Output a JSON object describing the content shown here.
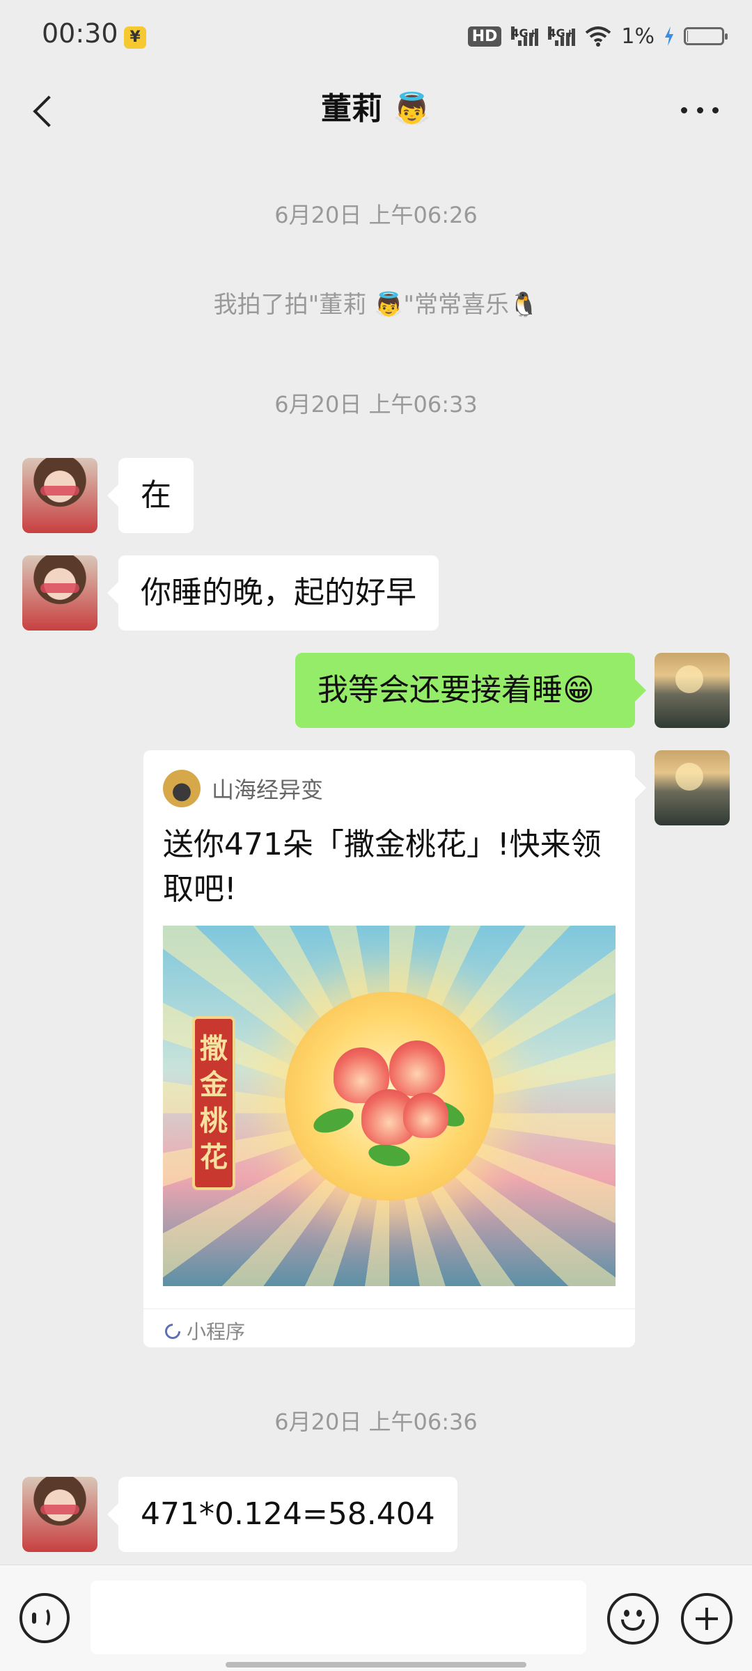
{
  "status_bar": {
    "time": "00:30",
    "payment_badge": "¥",
    "hd_label": "HD",
    "signal_1_label": "4G+",
    "signal_2_label": "4G+",
    "battery_percent": "1%",
    "icons": [
      "yuan-icon",
      "hd-icon",
      "signal-icon",
      "signal-icon",
      "wifi-icon",
      "charging-icon",
      "battery-icon"
    ]
  },
  "header": {
    "title": "董莉 👼",
    "back_icon": "back-chevron-icon",
    "more_icon": "more-dots-icon"
  },
  "chat": {
    "timestamp_1": "6月20日 上午06:26",
    "system_pat": "我拍了拍\"董莉 👼\"常常喜乐🐧",
    "timestamp_2": "6月20日 上午06:33",
    "msg_1": "在",
    "msg_2": "你睡的晚，起的好早",
    "msg_3": "我等会还要接着睡😁",
    "mini_program": {
      "app_name": "山海经异变",
      "title": "送你471朵「撒金桃花」!快来领取吧!",
      "banner_text": [
        "撒",
        "金",
        "桃",
        "花"
      ],
      "footer_label": "小程序"
    },
    "timestamp_3": "6月20日 上午06:36",
    "msg_4": "471*0.124=58.404"
  },
  "input_bar": {
    "text_value": "",
    "icons": [
      "voice-icon",
      "emoji-icon",
      "plus-icon"
    ]
  },
  "colors": {
    "background": "#ededed",
    "bubble_self": "#95ec69",
    "bubble_other": "#ffffff"
  }
}
